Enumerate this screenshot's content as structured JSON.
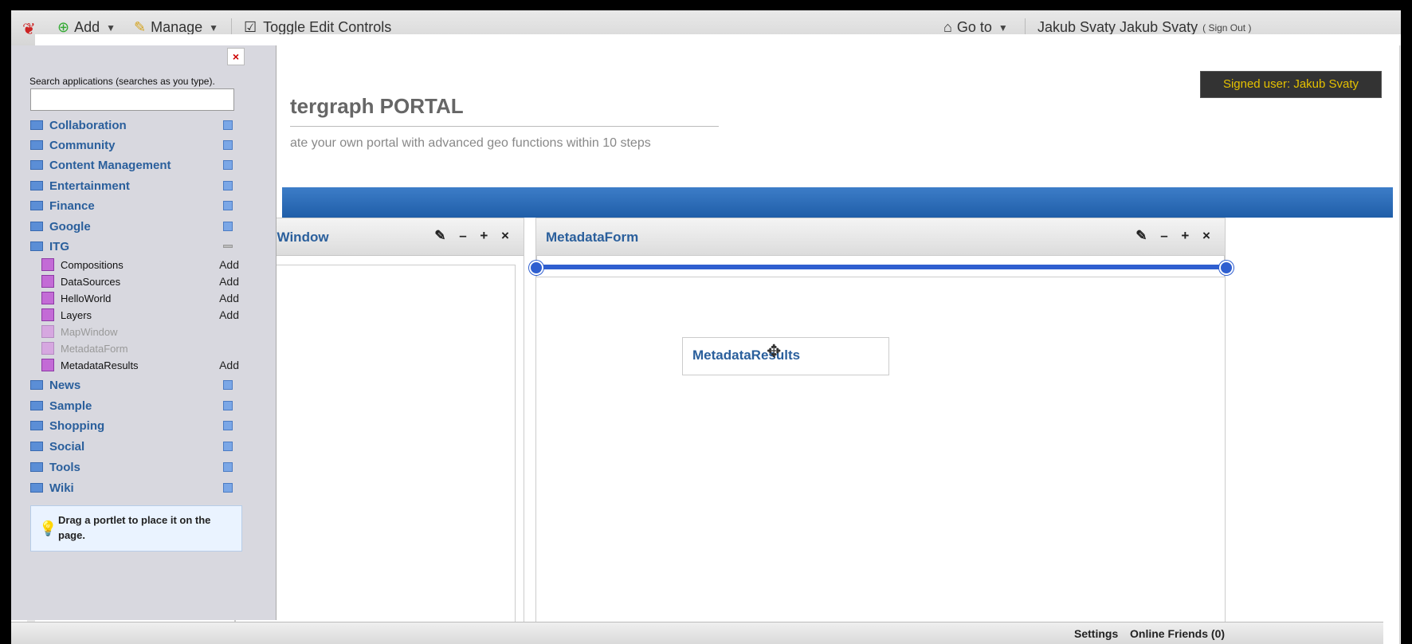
{
  "dock": {
    "add_label": "Add",
    "manage_label": "Manage",
    "toggle_label": "Toggle Edit Controls",
    "goto_label": "Go to",
    "user_label": "Jakub Svaty Jakub Svaty",
    "signout_label": "( Sign Out )"
  },
  "page": {
    "signed_user": "Signed user: Jakub Svaty",
    "portal_title": "tergraph PORTAL",
    "portal_subtitle": "ate your own portal with advanced geo functions within 10 steps"
  },
  "portlets": {
    "map_title": "lapWindow",
    "metadata_title": "MetadataForm",
    "controls": "✎ – + ×",
    "dragging_label": "MetadataResults"
  },
  "panel": {
    "close": "×",
    "search_label": "Search applications (searches as you type).",
    "search_value": "",
    "categories": [
      {
        "label": "Collaboration"
      },
      {
        "label": "Community"
      },
      {
        "label": "Content Management"
      },
      {
        "label": "Entertainment"
      },
      {
        "label": "Finance"
      },
      {
        "label": "Google"
      },
      {
        "label": "ITG"
      }
    ],
    "itg_apps": [
      {
        "label": "Compositions",
        "add": "Add"
      },
      {
        "label": "DataSources",
        "add": "Add"
      },
      {
        "label": "HelloWorld",
        "add": "Add"
      },
      {
        "label": "Layers",
        "add": "Add"
      },
      {
        "label": "MapWindow",
        "add": ""
      },
      {
        "label": "MetadataForm",
        "add": ""
      },
      {
        "label": "MetadataResults",
        "add": "Add"
      }
    ],
    "categories_after": [
      {
        "label": "News"
      },
      {
        "label": "Sample"
      },
      {
        "label": "Shopping"
      },
      {
        "label": "Social"
      },
      {
        "label": "Tools"
      },
      {
        "label": "Wiki"
      }
    ],
    "tip": "Drag a portlet to place it on the page."
  },
  "footer": {
    "settings": "Settings",
    "online_friends": "Online Friends (0)"
  }
}
